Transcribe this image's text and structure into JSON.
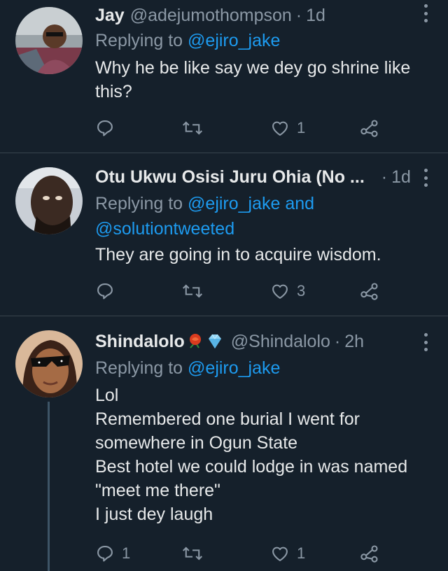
{
  "tweets": [
    {
      "name": "Jay",
      "handle": "@adejumothompson",
      "time": "1d",
      "replying_prefix": "Replying to",
      "replying_mentions": "@ejiro_jake",
      "replying_line2": "",
      "body_lines": [
        "Why he be like say we dey go shrine like",
        "this?"
      ],
      "reply_count": "",
      "like_count": "1"
    },
    {
      "name": "Otu Ukwu Osisi Juru Ohia (No ...",
      "handle": "",
      "time": "1d",
      "replying_prefix": "Replying to",
      "replying_mentions": "@ejiro_jake and",
      "replying_line2": "@solutiontweeted",
      "body_lines": [
        "They are going in to acquire wisdom."
      ],
      "reply_count": "",
      "like_count": "3"
    },
    {
      "name": "Shindalolo",
      "handle": "@Shindalolo",
      "time": "2h",
      "replying_prefix": "Replying to",
      "replying_mentions": "@ejiro_jake",
      "replying_line2": "",
      "body_lines": [
        "Lol",
        "Remembered one burial I went for",
        "somewhere in Ogun State",
        "Best hotel we could lodge in was named",
        "\"meet me there\"",
        "I just dey laugh"
      ],
      "reply_count": "1",
      "like_count": "1"
    }
  ],
  "icons": {
    "reply": "reply-icon",
    "retweet": "retweet-icon",
    "like": "heart-icon",
    "share": "share-icon",
    "more": "more-icon",
    "name_emojis": [
      "rose-icon",
      "gem-icon"
    ]
  },
  "colors": {
    "background": "#15202b",
    "divider": "#38444d",
    "text": "#e7e9ea",
    "muted": "#8b98a5",
    "link": "#1d9bf0"
  }
}
